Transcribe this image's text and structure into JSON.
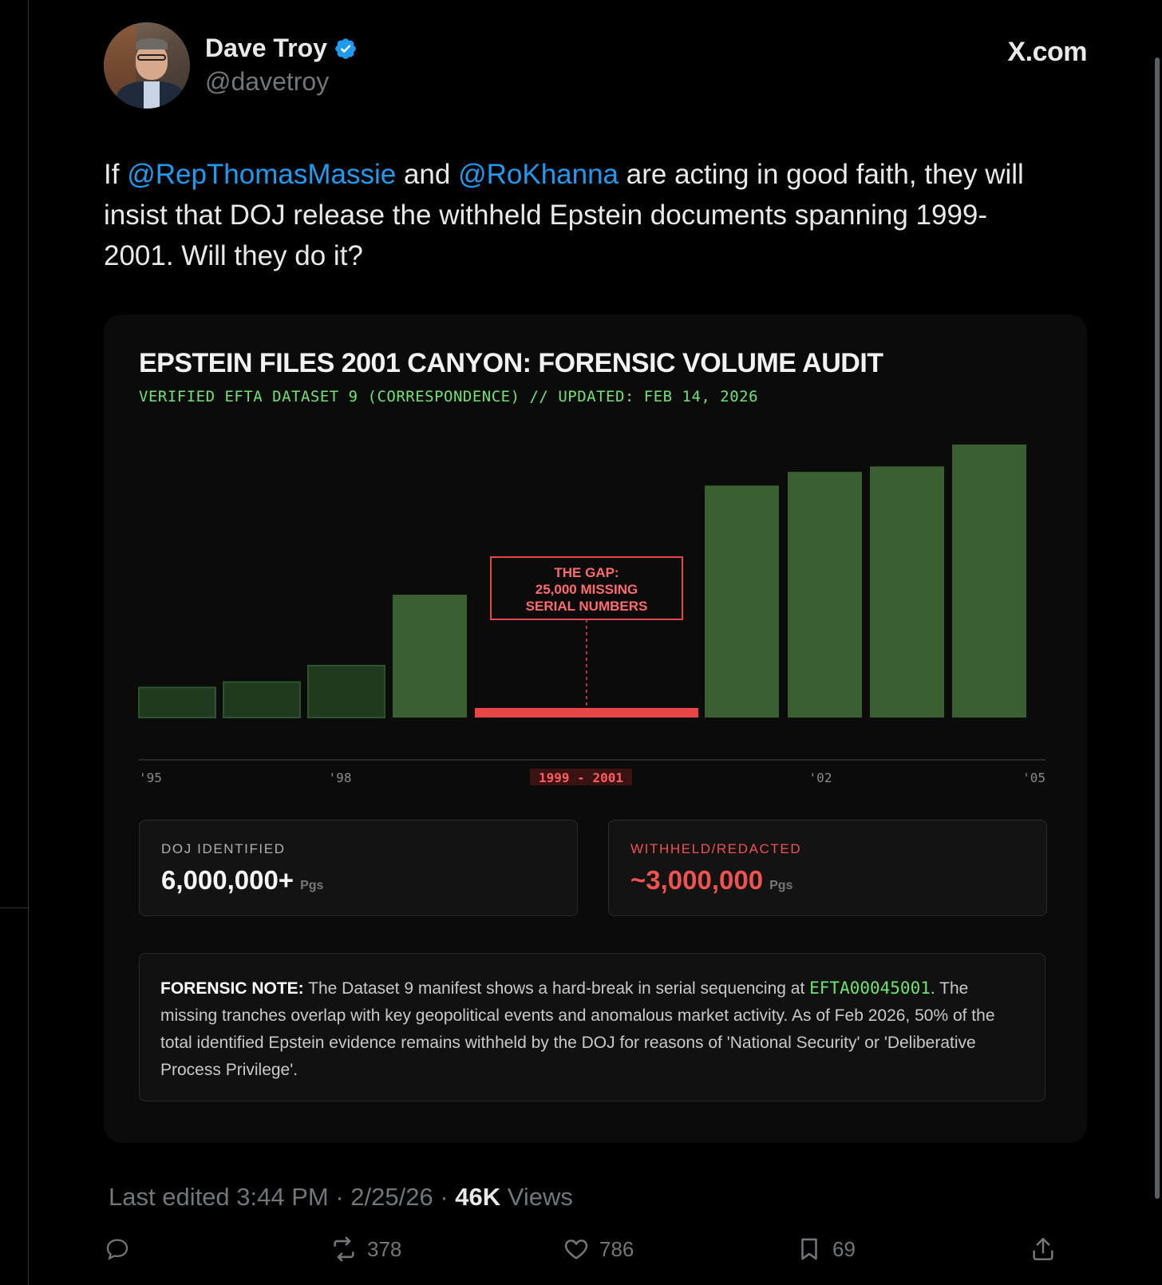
{
  "author": {
    "display_name": "Dave Troy",
    "handle": "@davetroy",
    "verified": true
  },
  "site_label": "X.com",
  "tweet": {
    "text_part1": "If ",
    "mention1": "@RepThomasMassie",
    "text_part2": " and ",
    "mention2": "@RoKhanna",
    "text_part3": " are acting in good faith, they will insist that DOJ release the withheld Epstein documents spanning 1999-2001. Will they do it?"
  },
  "card": {
    "title": "EPSTEIN FILES 2001 CANYON: FORENSIC VOLUME AUDIT",
    "subtitle": "VERIFIED EFTA DATASET 9 (CORRESPONDENCE) // UPDATED: FEB 14, 2026",
    "stats": [
      {
        "label": "DOJ IDENTIFIED",
        "value": "6,000,000+",
        "unit": "Pgs"
      },
      {
        "label": "WITHHELD/REDACTED",
        "value": "~3,000,000",
        "unit": "Pgs"
      }
    ],
    "note": {
      "label": "FORENSIC NOTE:",
      "text_before_code": " The Dataset 9 manifest shows a hard-break in serial sequencing at ",
      "code": "EFTA00045001",
      "text_after_code": ". The missing tranches overlap with key geopolitical events and anomalous market activity. As of Feb 2026, 50% of the total identified Epstein evidence remains withheld by the DOJ for reasons of 'National Security' or 'Deliberative Process Privilege'."
    }
  },
  "chart_data": {
    "type": "bar",
    "title": "",
    "ylim": [
      0,
      100
    ],
    "bars": [
      {
        "value": 11,
        "style": "dark"
      },
      {
        "value": 13,
        "style": "dark"
      },
      {
        "value": 19,
        "style": "dark"
      },
      {
        "value": 45,
        "style": "bright"
      },
      {
        "value": 3.5,
        "style": "gap"
      },
      {
        "value": 85,
        "style": "bright"
      },
      {
        "value": 90,
        "style": "bright"
      },
      {
        "value": 92,
        "style": "bright"
      },
      {
        "value": 100,
        "style": "bright"
      }
    ],
    "x_tick_labels": [
      "'95",
      "'98",
      "1999 - 2001",
      "'02",
      "'05"
    ],
    "highlight_tick": "1999 - 2001",
    "annotation_lines": [
      "THE GAP:",
      "25,000 MISSING",
      "SERIAL NUMBERS"
    ],
    "grid": false,
    "colors": {
      "dark_bar": "#1f3a1f",
      "dark_bar_border": "#2d552d",
      "bright_bar": "#3a5f30",
      "gap": "#e84545",
      "axis": "#2a2a2a"
    }
  },
  "footer": {
    "edited": "Last edited 3:44 PM · 2/25/26",
    "views_sep": "·",
    "views_count": "46K",
    "views_label": "Views"
  },
  "actions": {
    "reply_count": "",
    "retweet_count": "378",
    "like_count": "786",
    "bookmark_count": "69"
  }
}
